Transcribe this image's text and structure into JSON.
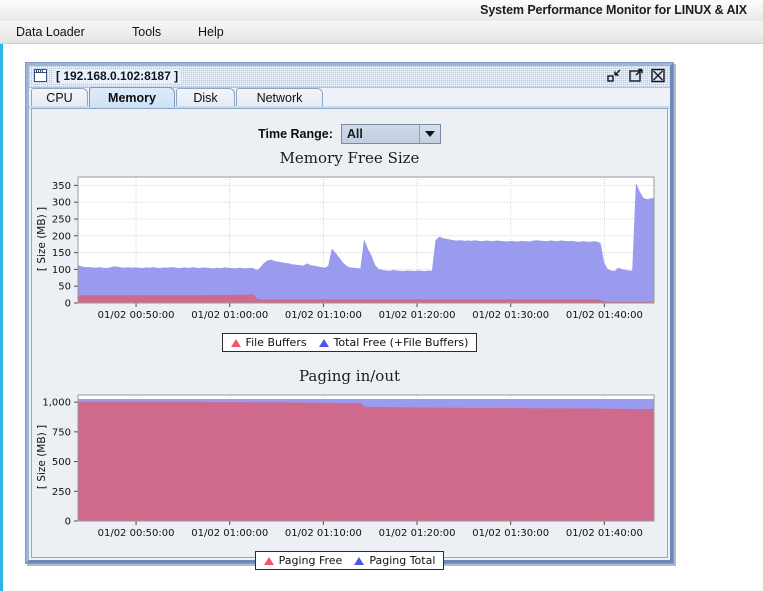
{
  "app": {
    "title": "System Performance Monitor for LINUX & AIX",
    "menu": [
      {
        "label": "Data Loader"
      },
      {
        "label": "Tools"
      },
      {
        "label": "Help"
      }
    ]
  },
  "window": {
    "title": "[ 192.168.0.102:8187 ]",
    "icon": "window-icon",
    "buttons": [
      {
        "name": "minimize-button",
        "label": "minimize-icon"
      },
      {
        "name": "maximize-button",
        "label": "maximize-icon"
      },
      {
        "name": "close-button",
        "label": "close-icon"
      }
    ]
  },
  "tabs": [
    {
      "label": "CPU",
      "selected": false
    },
    {
      "label": "Memory",
      "selected": true
    },
    {
      "label": "Disk",
      "selected": false
    },
    {
      "label": "Network",
      "selected": false
    }
  ],
  "toolbar": {
    "time_range_label": "Time Range:",
    "time_range_value": "All",
    "time_range_options": [
      "All"
    ]
  },
  "colors": {
    "series_red": "#d06a8c",
    "series_blue": "#9a9aee",
    "legend_marker_red": "#f4556a",
    "legend_marker_blue": "#4a59e8",
    "plot_background": "#ffffff",
    "panel_background": "#eceff4",
    "accent_stripe": "#29b6e8"
  },
  "chart_data": [
    {
      "type": "area",
      "name": "memory-free-size-chart",
      "title": "Memory Free Size",
      "xlabel": "",
      "ylabel": "[ Size (MB) ]",
      "ylim": [
        0,
        375
      ],
      "yticks": [
        0,
        50,
        100,
        150,
        200,
        250,
        300,
        350
      ],
      "ytick_labels": [
        "0",
        "50",
        "100",
        "150",
        "200",
        "250",
        "300",
        "350"
      ],
      "xticks": [
        "01/02 00:50:00",
        "01/02 01:00:00",
        "01/02 01:10:00",
        "01/02 01:20:00",
        "01/02 01:30:00",
        "01/02 01:40:00"
      ],
      "xlim": [
        "01/02 00:45:00",
        "01/02 01:42:30"
      ],
      "grid": true,
      "legend_position": "below",
      "stacked": true,
      "series": [
        {
          "name": "Total Free (+File Buffers)",
          "color": "#9a9aee",
          "marker": "triangle",
          "values": [
            112,
            108,
            106,
            106,
            105,
            104,
            106,
            104,
            103,
            105,
            108,
            107,
            105,
            104,
            106,
            104,
            105,
            104,
            103,
            105,
            104,
            106,
            104,
            103,
            105,
            104,
            106,
            105,
            103,
            104,
            105,
            103,
            106,
            104,
            103,
            105,
            104,
            103,
            102,
            104,
            103,
            105,
            104,
            103,
            102,
            104,
            103,
            102,
            104,
            103,
            97,
            105,
            118,
            126,
            128,
            124,
            122,
            120,
            118,
            117,
            114,
            113,
            112,
            110,
            117,
            112,
            110,
            108,
            106,
            104,
            110,
            160,
            148,
            134,
            120,
            110,
            105,
            104,
            103,
            102,
            186,
            160,
            140,
            112,
            100,
            98,
            96,
            95,
            97,
            96,
            95,
            94,
            96,
            95,
            94,
            96,
            95,
            94,
            96,
            95,
            186,
            196,
            192,
            190,
            188,
            186,
            185,
            186,
            184,
            185,
            184,
            186,
            184,
            183,
            185,
            184,
            183,
            185,
            184,
            183,
            182,
            184,
            183,
            182,
            184,
            183,
            182,
            184,
            186,
            185,
            184,
            183,
            185,
            184,
            183,
            185,
            184,
            183,
            184,
            182,
            181,
            183,
            182,
            181,
            183,
            182,
            178,
            120,
            100,
            96,
            94,
            104,
            100,
            98,
            96,
            96,
            354,
            330,
            312,
            308,
            310,
            312
          ]
        },
        {
          "name": "File Buffers",
          "color": "#d06a8c",
          "marker": "triangle",
          "values": [
            22,
            22,
            22,
            22,
            22,
            22,
            22,
            22,
            22,
            22,
            22,
            22,
            22,
            22,
            22,
            22,
            22,
            22,
            22,
            22,
            22,
            22,
            22,
            22,
            22,
            22,
            22,
            22,
            22,
            22,
            22,
            22,
            22,
            22,
            22,
            23,
            23,
            23,
            23,
            23,
            23,
            23,
            23,
            23,
            24,
            24,
            24,
            24,
            24,
            24,
            12,
            10,
            10,
            10,
            10,
            10,
            10,
            10,
            10,
            10,
            10,
            10,
            10,
            10,
            10,
            10,
            10,
            10,
            10,
            10,
            10,
            10,
            10,
            10,
            10,
            10,
            10,
            10,
            10,
            10,
            10,
            10,
            10,
            10,
            10,
            10,
            10,
            10,
            10,
            10,
            10,
            10,
            10,
            10,
            10,
            10,
            10,
            10,
            10,
            10,
            10,
            10,
            10,
            10,
            10,
            10,
            10,
            10,
            10,
            10,
            10,
            10,
            10,
            10,
            10,
            10,
            10,
            10,
            10,
            10,
            10,
            10,
            10,
            10,
            10,
            10,
            10,
            10,
            10,
            10,
            10,
            10,
            10,
            10,
            10,
            10,
            10,
            10,
            10,
            10,
            10,
            10,
            10,
            10,
            10,
            10,
            8,
            4,
            3,
            3,
            3,
            3,
            3,
            3,
            3,
            3,
            3,
            3,
            3,
            3,
            3,
            3
          ]
        }
      ]
    },
    {
      "type": "area",
      "name": "paging-in-out-chart",
      "title": "Paging in/out",
      "xlabel": "",
      "ylabel": "[ Size (MB) ]",
      "ylim": [
        0,
        1060
      ],
      "yticks": [
        0,
        250,
        500,
        750,
        1000
      ],
      "ytick_labels": [
        "0",
        "250",
        "500",
        "750",
        "1,000"
      ],
      "xticks": [
        "01/02 00:50:00",
        "01/02 01:00:00",
        "01/02 01:10:00",
        "01/02 01:20:00",
        "01/02 01:30:00",
        "01/02 01:40:00"
      ],
      "xlim": [
        "01/02 00:45:00",
        "01/02 01:42:30"
      ],
      "grid": true,
      "legend_position": "below",
      "stacked": true,
      "series": [
        {
          "name": "Paging Total",
          "color": "#9a9aee",
          "marker": "triangle",
          "values": [
            1024,
            1024,
            1024,
            1024,
            1024,
            1024,
            1024,
            1024,
            1024,
            1024,
            1024,
            1024,
            1024,
            1024,
            1024,
            1024,
            1024,
            1024,
            1024,
            1024,
            1024,
            1024,
            1024,
            1024,
            1024,
            1024,
            1024,
            1024,
            1024,
            1024,
            1024,
            1024,
            1024,
            1024,
            1024,
            1024,
            1024,
            1024,
            1024,
            1024,
            1024,
            1024,
            1024,
            1024,
            1024,
            1024,
            1024,
            1024,
            1024,
            1024,
            1024,
            1024,
            1024,
            1024,
            1024,
            1024,
            1024,
            1024,
            1024,
            1024,
            1024,
            1024,
            1024,
            1024,
            1024,
            1024,
            1024,
            1024,
            1024,
            1024,
            1024,
            1024,
            1024,
            1024,
            1024,
            1024,
            1024,
            1024,
            1024,
            1024,
            1024,
            1024,
            1024,
            1024,
            1024,
            1024,
            1024,
            1024,
            1024,
            1024,
            1024,
            1024,
            1024,
            1024,
            1024,
            1024,
            1024,
            1024,
            1024,
            1024,
            1024,
            1024,
            1024,
            1024,
            1024,
            1024,
            1024,
            1024,
            1024,
            1024,
            1024,
            1024,
            1024,
            1024,
            1024,
            1024,
            1024,
            1024,
            1024,
            1024,
            1024,
            1024,
            1024,
            1024,
            1024,
            1024,
            1024,
            1024,
            1024,
            1024,
            1024,
            1024,
            1024,
            1024,
            1024,
            1024,
            1024,
            1024,
            1024,
            1024,
            1024,
            1024,
            1024,
            1024,
            1024,
            1024,
            1024,
            1024,
            1024,
            1024,
            1024,
            1024,
            1024,
            1024,
            1024,
            1024,
            1024,
            1024,
            1024,
            1024,
            1024,
            1024
          ]
        },
        {
          "name": "Paging Free",
          "color": "#d06a8c",
          "marker": "triangle",
          "values": [
            1000,
            1000,
            1000,
            1000,
            1000,
            1000,
            1000,
            1000,
            1000,
            1000,
            1000,
            1000,
            1000,
            1000,
            1000,
            1000,
            1000,
            1000,
            1000,
            1000,
            1000,
            1000,
            1000,
            1000,
            1000,
            1000,
            1000,
            1000,
            1000,
            1000,
            1000,
            1000,
            1000,
            1000,
            1000,
            1000,
            998,
            998,
            998,
            998,
            998,
            998,
            998,
            998,
            998,
            998,
            998,
            997,
            997,
            997,
            997,
            996,
            996,
            996,
            996,
            996,
            995,
            995,
            995,
            995,
            994,
            994,
            994,
            994,
            993,
            993,
            993,
            993,
            992,
            992,
            992,
            991,
            991,
            990,
            990,
            989,
            989,
            989,
            988,
            988,
            960,
            958,
            957,
            957,
            956,
            956,
            955,
            955,
            955,
            954,
            954,
            954,
            953,
            953,
            953,
            952,
            952,
            952,
            952,
            951,
            951,
            951,
            951,
            950,
            950,
            950,
            950,
            950,
            950,
            949,
            949,
            949,
            949,
            949,
            948,
            948,
            948,
            948,
            948,
            948,
            947,
            947,
            947,
            947,
            947,
            947,
            946,
            946,
            946,
            946,
            946,
            946,
            945,
            945,
            945,
            945,
            945,
            945,
            944,
            944,
            944,
            944,
            944,
            943,
            943,
            943,
            943,
            942,
            942,
            942,
            942,
            941,
            941,
            941,
            941,
            940,
            940,
            940,
            940,
            940,
            940,
            940
          ]
        }
      ]
    }
  ]
}
